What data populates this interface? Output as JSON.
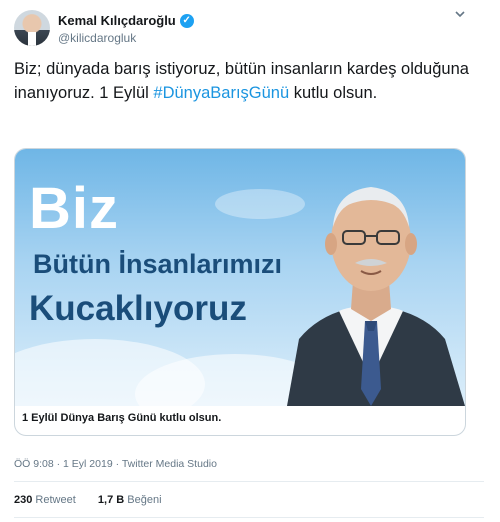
{
  "author": {
    "name": "Kemal Kılıçdaroğlu",
    "handle": "@kilicdarogluk",
    "verified": true
  },
  "tweet": {
    "text_before": "Biz; dünyada barış istiyoruz, bütün insanların kardeş olduğuna inanıyoruz. 1 Eylül ",
    "hashtag": "#DünyaBarışGünü",
    "text_after": " kutlu olsun."
  },
  "card": {
    "image_line_big": "Biz",
    "image_line_1": "Bütün İnsanlarımızı",
    "image_line_2": "Kucaklıyoruz",
    "caption": "1 Eylül Dünya Barış Günü kutlu olsun."
  },
  "meta": {
    "time": "ÖÖ 9:08",
    "separator1": " · ",
    "date": "1 Eyl 2019",
    "separator2": " · ",
    "source": "Twitter Media Studio"
  },
  "stats": {
    "retweets_count": "230",
    "retweets_label": "Retweet",
    "likes_count": "1,7 B",
    "likes_label": "Beğeni"
  },
  "colors": {
    "hashtag": "#1b95e0",
    "verified": "#1da1f2",
    "secondary_text": "#657786",
    "image_text": "#1a4d7a"
  }
}
